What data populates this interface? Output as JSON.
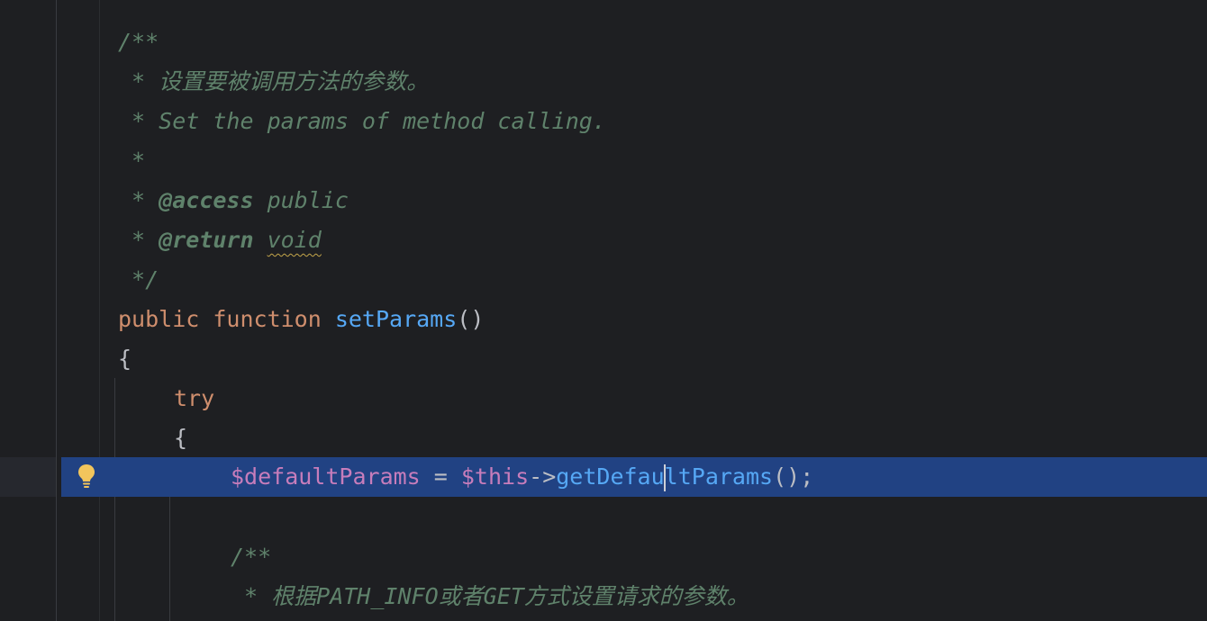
{
  "editor": {
    "lines": [
      {
        "text": "/**"
      },
      {
        "text": " * 设置要被调用方法的参数。"
      },
      {
        "text": " * Set the params of method calling."
      },
      {
        "text": " *"
      },
      {
        "star": " * ",
        "tag": "@access",
        "value": " public"
      },
      {
        "star": " * ",
        "tag": "@return",
        "value": "void"
      },
      {
        "text": " */"
      },
      {
        "kw": "public function ",
        "fn": "setParams",
        "rest": "()"
      },
      {
        "text": "{"
      },
      {
        "kw": "try"
      },
      {
        "text": "{"
      },
      {
        "var1": "$defaultParams",
        "op": " = ",
        "var2": "$this",
        "arrow": "->",
        "call_a": "getDefau",
        "call_b": "ltParams",
        "end": "();"
      },
      {
        "text": ""
      },
      {
        "text": "/**"
      },
      {
        "pre": " * 根据",
        "it1": "PATH_INFO",
        "mid": "或者",
        "it2": "GET",
        "post": "方式设置请求的参数。"
      }
    ],
    "icons": {
      "intention": "lightbulb-icon"
    },
    "colors": {
      "selection": "#214283",
      "doc_comment": "#5f826b",
      "keyword": "#cf8e6d",
      "function": "#56a8f5",
      "variable": "#c77dbb",
      "text": "#bcbec4",
      "background": "#1e1f22"
    }
  }
}
